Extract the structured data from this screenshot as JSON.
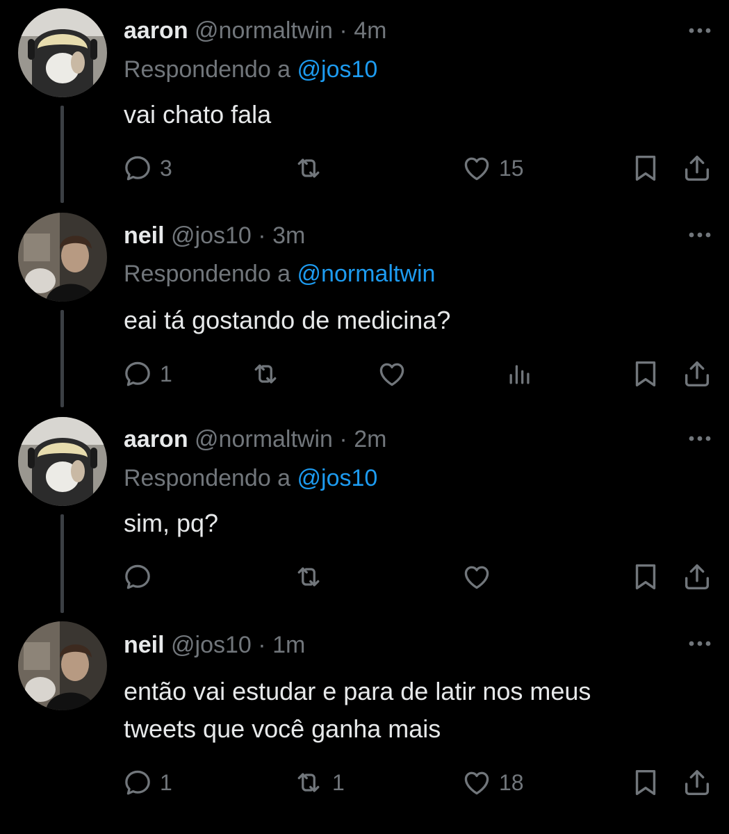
{
  "colors": {
    "background": "#000000",
    "text": "#e7e9ea",
    "muted": "#71767b",
    "mention": "#1d9bf0",
    "thread_line": "#3b3f44"
  },
  "tweets": [
    {
      "name": "aaron",
      "handle": "@normaltwin",
      "sep": "·",
      "time": "4m",
      "reply_prefix": "Respondendo a",
      "reply_to": "@jos10",
      "text": "vai chato fala",
      "replies": "3",
      "retweets": "",
      "likes": "15",
      "avatar": "avatar-aaron"
    },
    {
      "name": "neil",
      "handle": "@jos10",
      "sep": "·",
      "time": "3m",
      "reply_prefix": "Respondendo a",
      "reply_to": "@normaltwin",
      "text": "eai tá gostando de medicina?",
      "replies": "1",
      "retweets": "",
      "likes": "",
      "avatar": "avatar-neil"
    },
    {
      "name": "aaron",
      "handle": "@normaltwin",
      "sep": "·",
      "time": "2m",
      "reply_prefix": "Respondendo a",
      "reply_to": "@jos10",
      "text": "sim, pq?",
      "replies": "",
      "retweets": "",
      "likes": "",
      "avatar": "avatar-aaron"
    },
    {
      "name": "neil",
      "handle": "@jos10",
      "sep": "·",
      "time": "1m",
      "text_line1": "então vai estudar e para de latir nos meus",
      "text_line2": "tweets que você ganha mais",
      "replies": "1",
      "retweets": "1",
      "likes": "18",
      "avatar": "avatar-neil"
    }
  ],
  "icons": {
    "reply": "reply-icon",
    "retweet": "retweet-icon",
    "like": "heart-icon",
    "views": "analytics-icon",
    "bookmark": "bookmark-icon",
    "share": "share-icon",
    "more": "more-icon"
  }
}
